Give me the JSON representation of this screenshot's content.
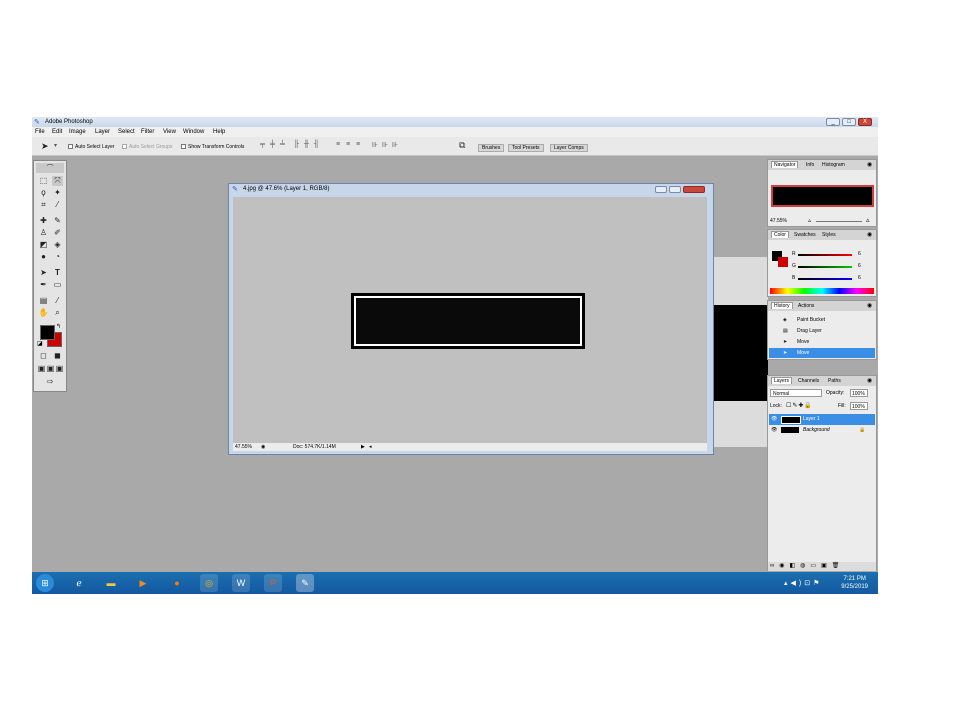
{
  "window": {
    "title": "Adobe Photoshop",
    "buttons": [
      "_",
      "□",
      "X"
    ]
  },
  "menu": [
    "File",
    "Edit",
    "Image",
    "Layer",
    "Select",
    "Filter",
    "View",
    "Window",
    "Help"
  ],
  "options_bar": {
    "auto_select_layer": "Auto Select Layer",
    "auto_select_groups": "Auto Select Groups",
    "show_transform_controls": "Show Transform Controls"
  },
  "well_tabs": [
    "Brushes",
    "Tool Presets",
    "Layer Comps"
  ],
  "document": {
    "title": "4.jpg @ 47.6% (Layer 1, RGB/8)",
    "zoom": "47.55%",
    "doc_info": "Doc: 574.7K/1.14M"
  },
  "navigator": {
    "tabs": [
      "Navigator",
      "Info",
      "Histogram"
    ],
    "zoom": "47.55%"
  },
  "color": {
    "tabs": [
      "Color",
      "Swatches",
      "Styles"
    ],
    "channels": [
      {
        "label": "R",
        "value": "6"
      },
      {
        "label": "G",
        "value": "6"
      },
      {
        "label": "B",
        "value": "6"
      }
    ]
  },
  "history": {
    "tabs": [
      "History",
      "Actions"
    ],
    "items": [
      "Paint Bucket",
      "Drag Layer",
      "Move",
      "Move"
    ]
  },
  "layers": {
    "tabs": [
      "Layers",
      "Channels",
      "Paths"
    ],
    "blend_mode": "Normal",
    "opacity_label": "Opacity:",
    "opacity": "100%",
    "lock_label": "Lock:",
    "fill_label": "Fill:",
    "fill": "100%",
    "items": [
      "Layer 1",
      "Background"
    ]
  },
  "taskbar": {
    "time": "7:21 PM",
    "date": "9/25/2019"
  },
  "colors": {
    "accent": "#3a8ee6",
    "taskbar": "#1459a0",
    "foreground": "#000000",
    "background_swatch": "#cc0000"
  }
}
